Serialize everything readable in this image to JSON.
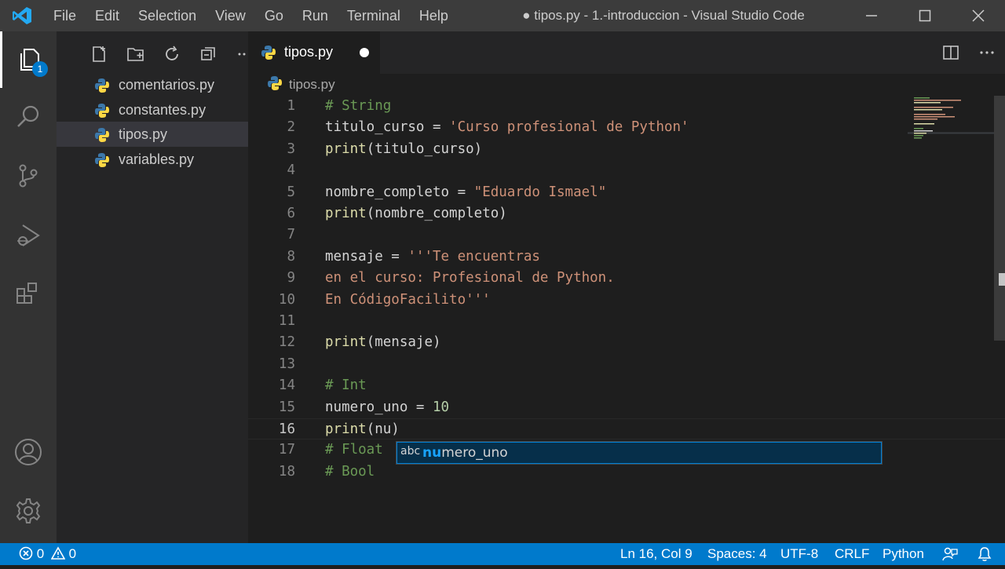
{
  "menu": [
    "File",
    "Edit",
    "Selection",
    "View",
    "Go",
    "Run",
    "Terminal",
    "Help"
  ],
  "window_title": "● tipos.py - 1.-introduccion - Visual Studio Code",
  "activity": {
    "explorer_badge": "1"
  },
  "explorer": {
    "files": [
      {
        "name": "comentarios.py",
        "selected": false
      },
      {
        "name": "constantes.py",
        "selected": false
      },
      {
        "name": "tipos.py",
        "selected": true
      },
      {
        "name": "variables.py",
        "selected": false
      }
    ]
  },
  "tab": {
    "name": "tipos.py",
    "dirty": true
  },
  "breadcrumb": {
    "file": "tipos.py"
  },
  "code": {
    "current_line": 16,
    "lines": [
      {
        "num": "1",
        "tokens": [
          {
            "t": "# String",
            "c": "c"
          }
        ]
      },
      {
        "num": "2",
        "tokens": [
          {
            "t": "titulo_curso",
            "c": "v"
          },
          {
            "t": " = ",
            "c": "p"
          },
          {
            "t": "'Curso profesional de Python'",
            "c": "s"
          }
        ]
      },
      {
        "num": "3",
        "tokens": [
          {
            "t": "print",
            "c": "f"
          },
          {
            "t": "(titulo_curso)",
            "c": "p"
          }
        ]
      },
      {
        "num": "4",
        "tokens": []
      },
      {
        "num": "5",
        "tokens": [
          {
            "t": "nombre_completo",
            "c": "v"
          },
          {
            "t": " = ",
            "c": "p"
          },
          {
            "t": "\"Eduardo Ismael\"",
            "c": "s"
          }
        ]
      },
      {
        "num": "6",
        "tokens": [
          {
            "t": "print",
            "c": "f"
          },
          {
            "t": "(nombre_completo)",
            "c": "p"
          }
        ]
      },
      {
        "num": "7",
        "tokens": []
      },
      {
        "num": "8",
        "tokens": [
          {
            "t": "mensaje",
            "c": "v"
          },
          {
            "t": " = ",
            "c": "p"
          },
          {
            "t": "'''Te encuentras",
            "c": "s"
          }
        ]
      },
      {
        "num": "9",
        "tokens": [
          {
            "t": "en el curso: Profesional de Python.",
            "c": "s"
          }
        ]
      },
      {
        "num": "10",
        "tokens": [
          {
            "t": "En CódigoFacilito'''",
            "c": "s"
          }
        ]
      },
      {
        "num": "11",
        "tokens": []
      },
      {
        "num": "12",
        "tokens": [
          {
            "t": "print",
            "c": "f"
          },
          {
            "t": "(mensaje)",
            "c": "p"
          }
        ]
      },
      {
        "num": "13",
        "tokens": []
      },
      {
        "num": "14",
        "tokens": [
          {
            "t": "# Int",
            "c": "c"
          }
        ]
      },
      {
        "num": "15",
        "tokens": [
          {
            "t": "numero_uno",
            "c": "v"
          },
          {
            "t": " = ",
            "c": "p"
          },
          {
            "t": "10",
            "c": "n"
          }
        ]
      },
      {
        "num": "16",
        "tokens": [
          {
            "t": "print",
            "c": "f"
          },
          {
            "t": "(nu)",
            "c": "p"
          }
        ]
      },
      {
        "num": "17",
        "tokens": [
          {
            "t": "# Float",
            "c": "c"
          }
        ]
      },
      {
        "num": "18",
        "tokens": [
          {
            "t": "# Bool",
            "c": "c"
          }
        ]
      }
    ]
  },
  "suggest": {
    "kind": "abc",
    "match": "nu",
    "rest": "mero_uno"
  },
  "status": {
    "errors": "0",
    "warnings": "0",
    "position": "Ln 16, Col 9",
    "spaces": "Spaces: 4",
    "encoding": "UTF-8",
    "eol": "CRLF",
    "language": "Python"
  }
}
